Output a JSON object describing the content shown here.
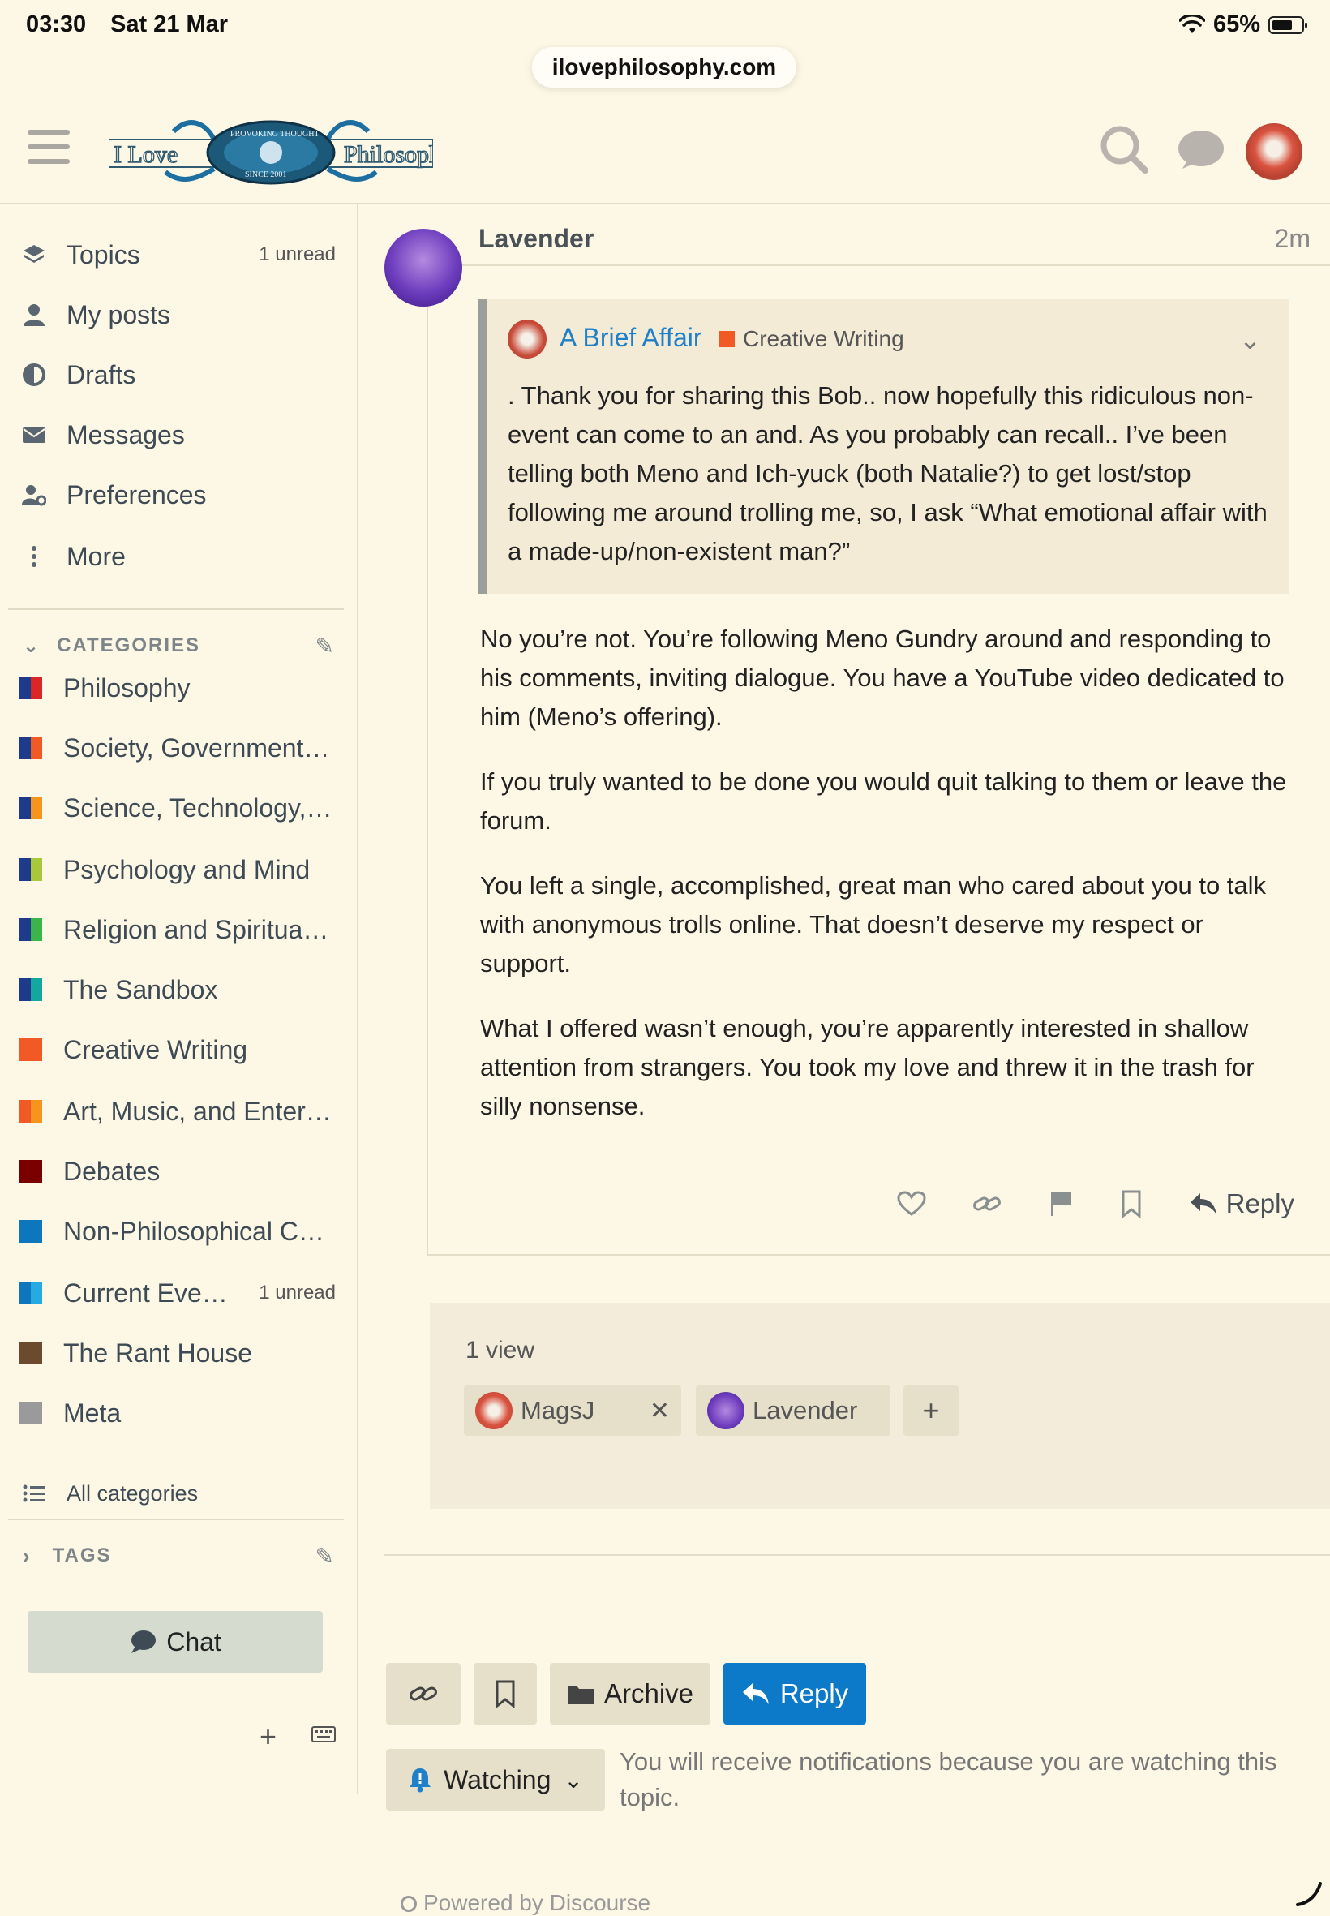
{
  "status_bar": {
    "time": "03:30",
    "date": "Sat 21 Mar",
    "battery": "65%"
  },
  "browser": {
    "url": "ilovephilosophy.com"
  },
  "header": {
    "logo_alt": "I Love Philosophy",
    "logo_ring": "PROVOKING THOUGHT SINCE 2001"
  },
  "sidebar": {
    "nav": [
      {
        "label": "Topics",
        "badge": "1 unread",
        "icon": "layers-icon"
      },
      {
        "label": "My posts",
        "badge": "",
        "icon": "user-icon"
      },
      {
        "label": "Drafts",
        "badge": "",
        "icon": "half-circle-icon"
      },
      {
        "label": "Messages",
        "badge": "",
        "icon": "envelope-icon"
      },
      {
        "label": "Preferences",
        "badge": "",
        "icon": "user-gear-icon"
      },
      {
        "label": "More",
        "badge": "",
        "icon": "ellipsis-vertical-icon"
      }
    ],
    "categories_heading": "CATEGORIES",
    "categories": [
      {
        "label": "Philosophy",
        "badge": "",
        "colors": [
          "#1e3a8a",
          "#dc2626"
        ]
      },
      {
        "label": "Society, Government…",
        "badge": "",
        "colors": [
          "#1e3a8a",
          "#f15a24"
        ]
      },
      {
        "label": "Science, Technology,…",
        "badge": "",
        "colors": [
          "#1e3a8a",
          "#f7941d"
        ]
      },
      {
        "label": "Psychology and Mind",
        "badge": "",
        "colors": [
          "#1e3a8a",
          "#a8c83a"
        ]
      },
      {
        "label": "Religion and Spiritua…",
        "badge": "",
        "colors": [
          "#1e3a8a",
          "#3ab54a"
        ]
      },
      {
        "label": "The Sandbox",
        "badge": "",
        "colors": [
          "#1e3a8a",
          "#12a89d"
        ]
      },
      {
        "label": "Creative Writing",
        "badge": "",
        "colors": [
          "#f15a24",
          "#f15a24"
        ]
      },
      {
        "label": "Art, Music, and Enter…",
        "badge": "",
        "colors": [
          "#f15a24",
          "#f7941d"
        ]
      },
      {
        "label": "Debates",
        "badge": "",
        "colors": [
          "#7a0000",
          "#7a0000"
        ]
      },
      {
        "label": "Non-Philosophical C…",
        "badge": "",
        "colors": [
          "#0e76bd",
          "#0e76bd"
        ]
      },
      {
        "label": "Current Eve…",
        "badge": "1 unread",
        "colors": [
          "#0e76bd",
          "#25aae1"
        ]
      },
      {
        "label": "The Rant House",
        "badge": "",
        "colors": [
          "#6b4a2e",
          "#6b4a2e"
        ]
      },
      {
        "label": "Meta",
        "badge": "",
        "colors": [
          "#9a9a9a",
          "#9a9a9a"
        ]
      }
    ],
    "all_categories": "All categories",
    "tags_heading": "TAGS",
    "chat_label": "Chat"
  },
  "post": {
    "author": "Lavender",
    "time": "2m",
    "quote": {
      "topic": "A Brief Affair",
      "category": "Creative Writing",
      "text": ". Thank you for sharing this Bob.. now hopefully this ridiculous non-event can come to an and. As you probably can recall.. I’ve been telling both Meno and Ich-yuck (both Natalie?) to get lost/stop following me around trolling me, so, I ask “What emotional affair with a made-up/non-existent man?”"
    },
    "paragraphs": [
      "No you’re not. You’re following Meno Gundry around and responding to his comments, inviting dialogue. You have a YouTube video dedicated to him (Meno’s offering).",
      "If you truly wanted to be done you would quit talking to them or leave the forum.",
      "You left a single, accomplished, great man who cared about you to talk with anonymous trolls online. That doesn’t deserve my respect or support.",
      "What I offered wasn’t enough, you’re apparently interested in shallow attention from strangers. You took my love and threw it in the trash for silly nonsense."
    ],
    "reply_label": "Reply"
  },
  "views": {
    "label": "1 view",
    "users": [
      "MagsJ",
      "Lavender"
    ]
  },
  "footer_buttons": {
    "archive": "Archive",
    "reply": "Reply",
    "watching": "Watching",
    "watching_text": "You will receive notifications because you are watching this topic."
  },
  "powered_by": "Powered by Discourse",
  "colors": {
    "accent": "#0d79c9",
    "background": "#fdf7e5",
    "link": "#1f7fc8"
  }
}
